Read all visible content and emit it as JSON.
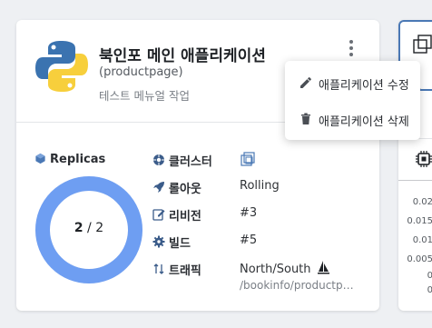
{
  "app": {
    "title": "북인포 메인 애플리케이션",
    "name": "(productpage)",
    "description": "테스트 메뉴얼 작업"
  },
  "replicas": {
    "label": "Replicas",
    "current": "2",
    "separator": "/",
    "total": "2",
    "ready_fraction": 1.0
  },
  "details": [
    {
      "label": "클러스터",
      "value": "",
      "icon": "cluster-icon"
    },
    {
      "label": "롤아웃",
      "value": "Rolling",
      "icon": "rocket-icon"
    },
    {
      "label": "리비전",
      "value": "#3",
      "icon": "edit-icon"
    },
    {
      "label": "빌드",
      "value": "#5",
      "icon": "gear-icon"
    },
    {
      "label": "트래픽",
      "value": "North/South",
      "sub": "/bookinfo/productpage",
      "icon": "traffic-arrows-icon"
    }
  ],
  "menu": {
    "edit_label": "애플리케이션 수정",
    "delete_label": "애플리케이션 삭제"
  },
  "side_panel": {
    "slash": "/",
    "ticks": [
      "0.02",
      "0.015",
      "0.01",
      "0.005",
      "0",
      "0"
    ]
  },
  "colors": {
    "accent": "#6e9ef2",
    "tab_border": "#4a78b5"
  }
}
